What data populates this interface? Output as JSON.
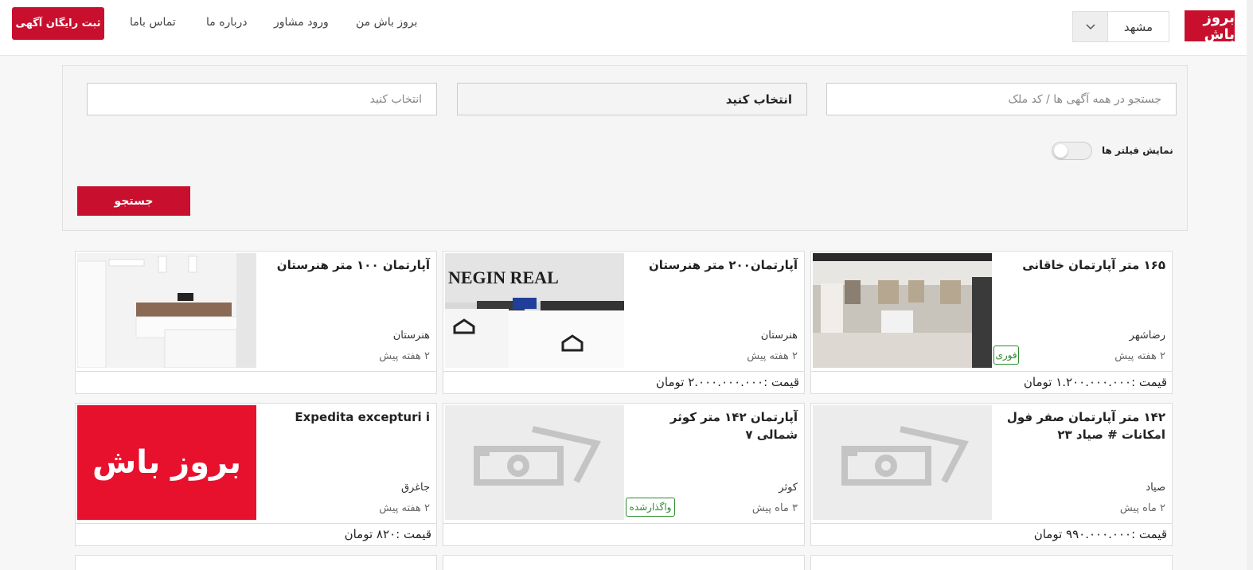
{
  "header": {
    "logo_text": "بروز باش",
    "city": "مشهد",
    "nav": [
      "بروز باش من",
      "ورود مشاور",
      "درباره ما",
      "تماس باما"
    ],
    "post_button": "ثبت رایگان آگهی"
  },
  "search": {
    "query_placeholder": "جستجو در همه آگهی ها / کد ملک",
    "select_1": "انتخاب کنید",
    "select_2": "انتخاب کنید",
    "filters_label": "نمایش فیلتر ها",
    "submit": "جستجو"
  },
  "listings": [
    {
      "title": "۱۶۵ متر آپارتمان خاقانی",
      "location": "رضاشهر",
      "time": "۲ هفته پیش",
      "price": "قیمت :۱.۲۰۰.۰۰۰.۰۰۰ تومان",
      "badge": "فوری",
      "image": "interior-room"
    },
    {
      "title": "آپارتمان۲۰۰ متر هنرستان",
      "location": "هنرستان",
      "time": "۲ هفته پیش",
      "price": "قیمت :۲.۰۰۰.۰۰۰.۰۰۰ تومان",
      "badge": "",
      "image": "negin-office",
      "image_text": "NEGIN REAL"
    },
    {
      "title": "آپارتمان ۱۰۰ متر هنرستان",
      "location": "هنرستان",
      "time": "۲ هفته پیش",
      "price": "",
      "badge": "",
      "image": "kitchen"
    },
    {
      "title": "۱۴۲ متر آپارتمان صفر فول امکانات # صیاد ۲۳",
      "location": "صیاد",
      "time": "۲ ماه پیش",
      "price": "قیمت :۹۹۰.۰۰۰.۰۰۰ تومان",
      "badge": "",
      "image": "placeholder-camera"
    },
    {
      "title": "آپارتمان ۱۴۲ متر کوثر شمالی ۷",
      "location": "کوثر",
      "time": "۳ ماه پیش",
      "price": "",
      "badge": "واگذارشده",
      "image": "placeholder-camera"
    },
    {
      "title": "Expedita excepturi i",
      "location": "جاغرق",
      "time": "۲ هفته پیش",
      "price": "قیمت :۸۲۰ تومان",
      "badge": "",
      "image": "brand-logo",
      "image_text": "بروز باش"
    }
  ],
  "colors": {
    "brand": "#c8102e",
    "badge_green": "#2d8a2d"
  }
}
